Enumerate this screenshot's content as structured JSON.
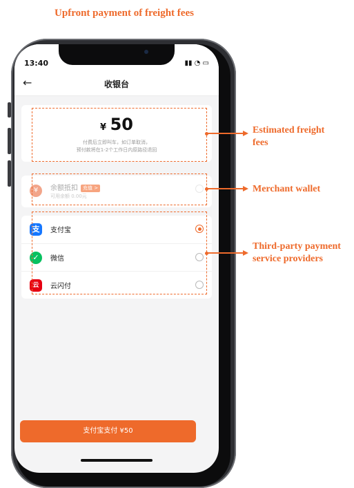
{
  "top_caption": "Upfront payment of freight fees",
  "status_bar": {
    "time": "13:40",
    "icons": "▮▮ ◔ ▭"
  },
  "nav": {
    "back_icon": "←",
    "title": "收银台"
  },
  "amount": {
    "currency": "¥",
    "value": "50",
    "note_line1": "付费后立即叫车，如订单取消，",
    "note_line2": "预付款将在1-2个工作日内原路径退回"
  },
  "wallet": {
    "icon": "¥",
    "label": "余额抵扣",
    "topup_label": "充值 >",
    "subtext": "可用余额 0.00元"
  },
  "payment_methods": [
    {
      "label": "支付宝",
      "icon": "支",
      "color": "#1677ff",
      "selected": true
    },
    {
      "label": "微信",
      "icon": "✓",
      "color": "#07c160",
      "selected": false
    },
    {
      "label": "云闪付",
      "icon": "云",
      "color": "#e60012",
      "selected": false
    }
  ],
  "pay_button": "支付宝支付 ¥50",
  "annotations": {
    "estimated": "Estimated freight fees",
    "wallet": "Merchant wallet",
    "third_party": "Third-party payment service providers"
  },
  "accent_color": "#ee6a2b"
}
